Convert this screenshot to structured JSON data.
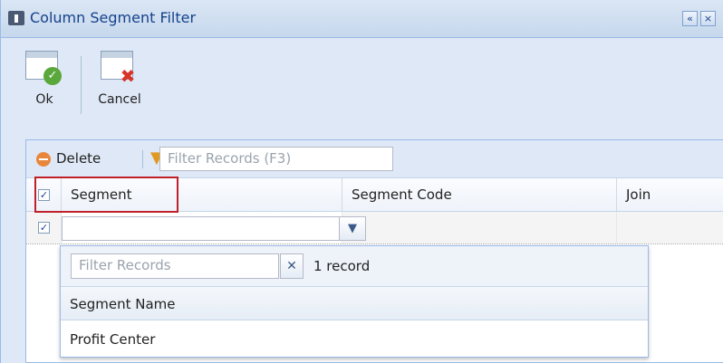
{
  "window": {
    "title": "Column Segment Filter",
    "controls": {
      "collapse": "«",
      "close": "×"
    }
  },
  "toolbar": {
    "ok_label": "Ok",
    "cancel_label": "Cancel"
  },
  "grid_toolbar": {
    "delete_label": "Delete",
    "filter_placeholder": "Filter Records (F3)"
  },
  "grid": {
    "columns": [
      "Segment",
      "Segment Code",
      "Join"
    ],
    "rows": [
      {
        "checked": true,
        "segment": "",
        "segment_code": "",
        "join": ""
      }
    ]
  },
  "dropdown": {
    "filter_placeholder": "Filter Records",
    "record_count": "1 record",
    "column_header": "Segment Name",
    "items": [
      "Profit Center"
    ]
  },
  "icons": {
    "ok": "window-check-icon",
    "cancel": "window-delete-icon",
    "delete": "minus-circle-icon",
    "filter": "funnel-icon"
  },
  "colors": {
    "accent": "#15428b",
    "highlight_border": "#c0202a"
  }
}
